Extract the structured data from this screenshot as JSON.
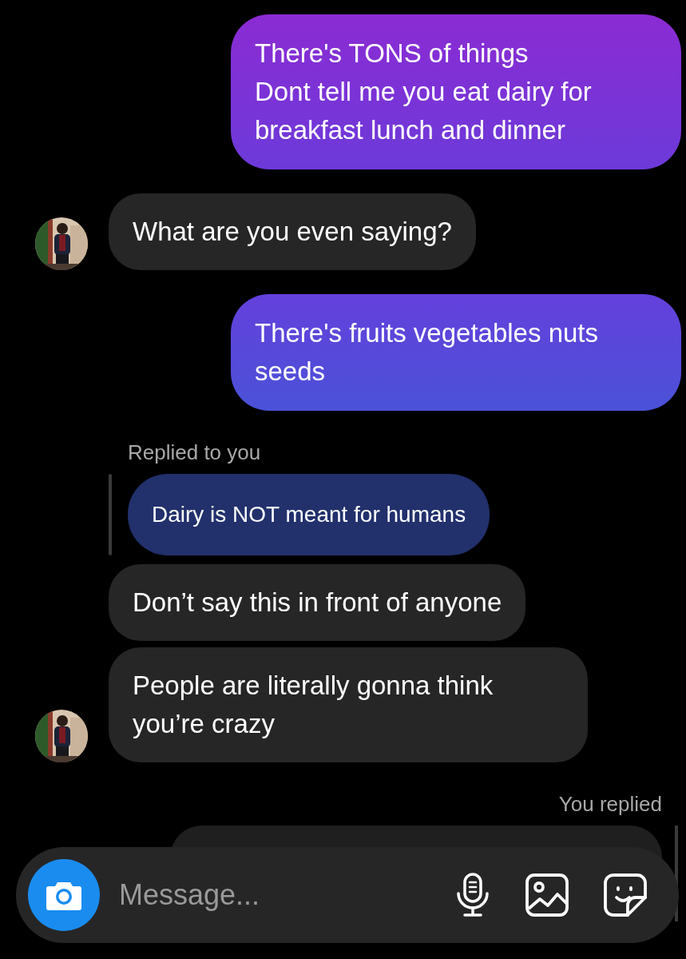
{
  "messages": [
    {
      "kind": "sent",
      "text": "There's TONS of things\nDont tell me you eat dairy for breakfast lunch and dinner"
    },
    {
      "kind": "received",
      "text": "What are you even saying?",
      "avatar": true
    },
    {
      "kind": "sent",
      "text": "There's fruits vegetables nuts seeds"
    },
    {
      "kind": "reply_label",
      "text": "Replied to you"
    },
    {
      "kind": "quote",
      "text": "Dairy is NOT meant for humans"
    },
    {
      "kind": "received",
      "text": "Don’t say this in front of anyone",
      "avatar": false
    },
    {
      "kind": "received",
      "text": "People are literally gonna think you’re crazy",
      "avatar": true
    },
    {
      "kind": "reply_label_sent",
      "text": "You replied"
    },
    {
      "kind": "hidden_bubble"
    }
  ],
  "composer": {
    "placeholder": "Message..."
  }
}
